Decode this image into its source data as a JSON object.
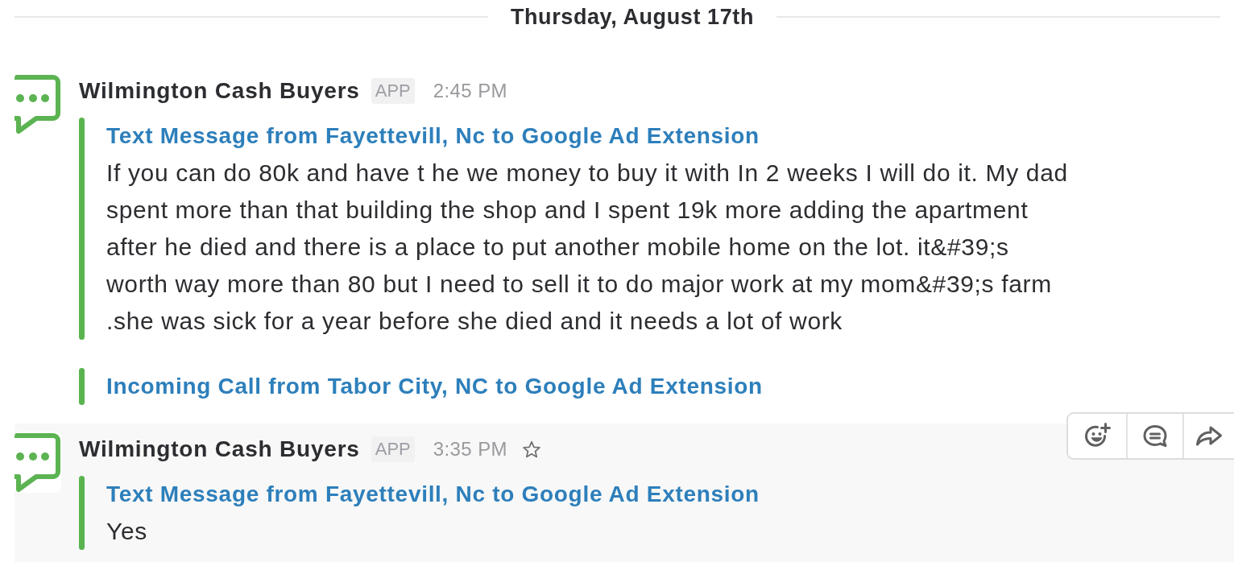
{
  "date_divider": {
    "label": "Thursday, August 17th"
  },
  "messages": [
    {
      "sender": "Wilmington Cash Buyers",
      "badge": "APP",
      "time": "2:45 PM",
      "hovered": false,
      "starred": false,
      "attachments": [
        {
          "title": "Text Message from Fayettevill, Nc to Google Ad Extension",
          "text": "If you can do 80k and have t he we money to buy it with In 2 weeks I will do it. My dad spent more than that building the shop and I spent 19k more adding the apartment after he died and there is a place to put another mobile home on the lot. it&#39;s worth way more than 80 but I need to sell it to do major work at my mom&#39;s farm .she was sick for a year before she died and it needs a lot of work"
        },
        {
          "title": "Incoming Call from Tabor City, NC to Google Ad Extension"
        }
      ]
    },
    {
      "sender": "Wilmington Cash Buyers",
      "badge": "APP",
      "time": "3:35 PM",
      "hovered": true,
      "starred": false,
      "attachments": [
        {
          "title": "Text Message from Fayettevill, Nc to Google Ad Extension",
          "text": "Yes"
        }
      ],
      "actions": [
        {
          "kind": "reaction"
        },
        {
          "kind": "reply"
        },
        {
          "kind": "share"
        }
      ]
    }
  ]
}
